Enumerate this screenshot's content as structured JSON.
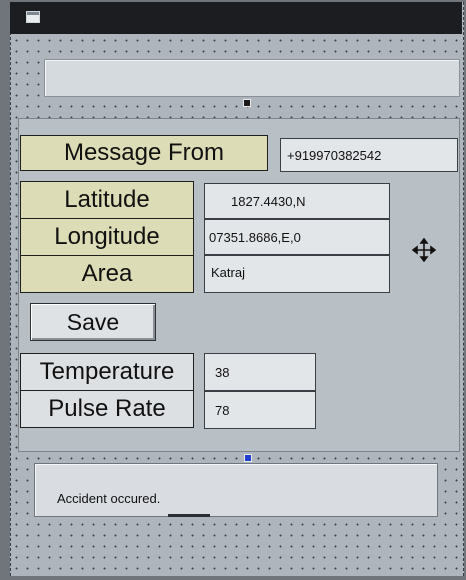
{
  "form": {
    "window_icon": "form-window-icon",
    "top_textbox_value": ""
  },
  "message": {
    "from_label": "Message From",
    "from_value": "+919970382542"
  },
  "location": {
    "latitude_label": "Latitude",
    "latitude_value": "1827.4430,N",
    "longitude_label": "Longitude",
    "longitude_value": "07351.8686,E,0",
    "area_label": "Area",
    "area_value": "Katraj"
  },
  "save_label": "Save",
  "vitals": {
    "temperature_label": "Temperature",
    "temperature_value": "38",
    "pulse_label": "Pulse Rate",
    "pulse_value": "78"
  },
  "status": {
    "message": "Accident occured."
  },
  "icons": {
    "move": "move-icon"
  },
  "colors": {
    "designer_bg": "#aeb5bc",
    "label_gold": "#dcdcb6",
    "titlebar": "#1c1d20"
  }
}
